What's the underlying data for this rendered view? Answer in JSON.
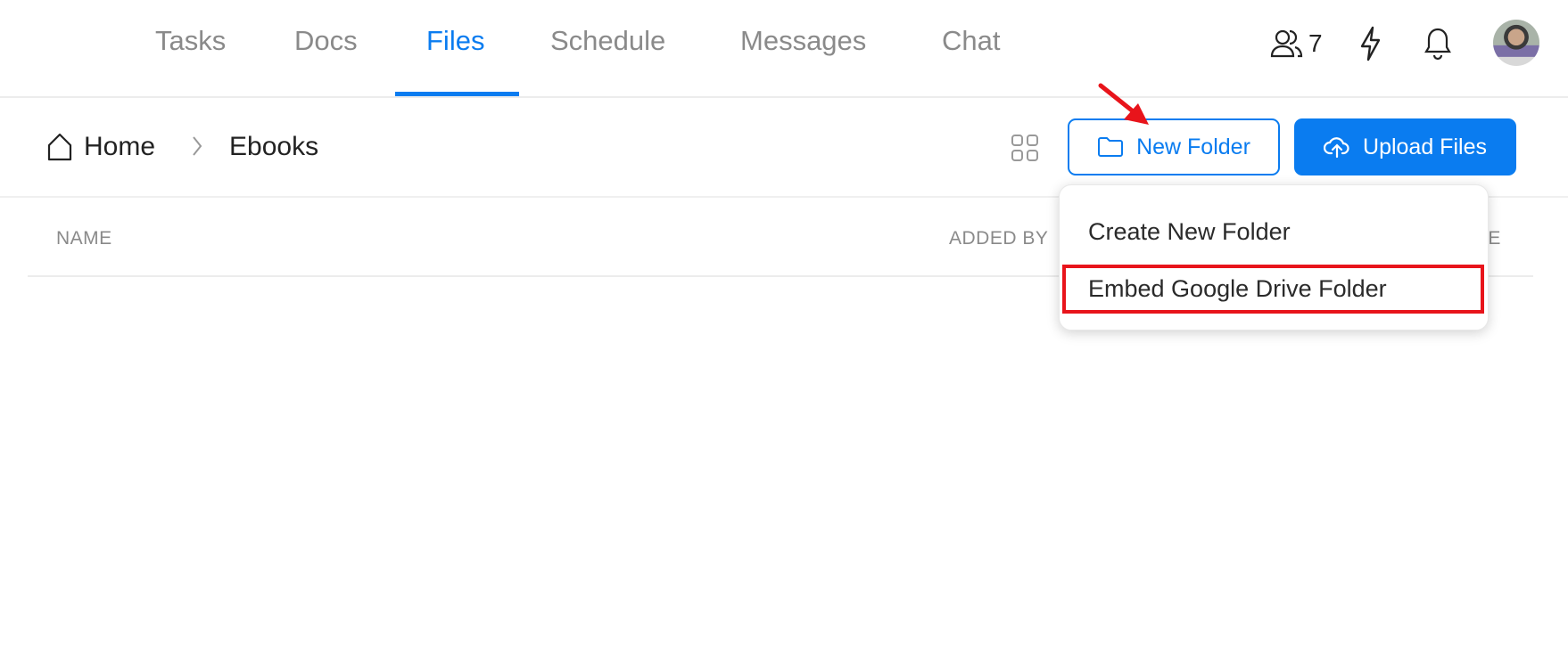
{
  "nav": {
    "tabs": [
      {
        "label": "Tasks"
      },
      {
        "label": "Docs"
      },
      {
        "label": "Files",
        "active": true
      },
      {
        "label": "Schedule"
      },
      {
        "label": "Messages"
      },
      {
        "label": "Chat"
      }
    ],
    "members_count": "7",
    "icons": [
      "users-icon",
      "bolt-icon",
      "bell-icon",
      "avatar"
    ]
  },
  "breadcrumb": {
    "home": "Home",
    "current": "Ebooks"
  },
  "toolbar": {
    "new_folder": "New Folder",
    "upload_files": "Upload Files"
  },
  "table": {
    "headers": [
      "NAME",
      "ADDED BY",
      "ZE"
    ]
  },
  "dropdown": {
    "items": [
      "Create New Folder",
      "Embed Google Drive Folder"
    ],
    "highlighted_index": 1
  },
  "colors": {
    "accent": "#0a7cf0",
    "annotation": "#e8141b"
  }
}
